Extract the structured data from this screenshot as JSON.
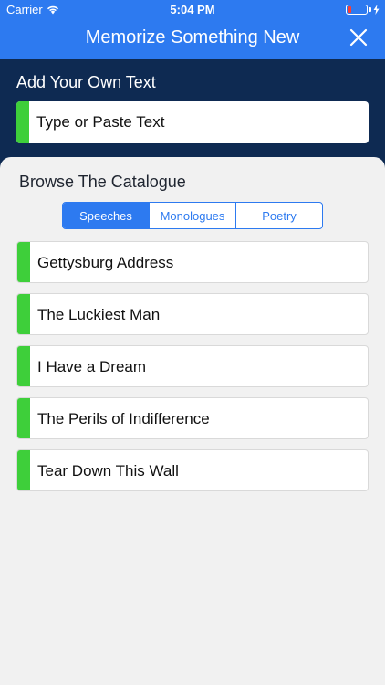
{
  "status_bar": {
    "carrier": "Carrier",
    "time": "5:04 PM"
  },
  "nav": {
    "title": "Memorize Something New"
  },
  "add_section": {
    "heading": "Add Your Own Text",
    "input_label": "Type or Paste Text"
  },
  "catalogue": {
    "heading": "Browse The Catalogue",
    "tabs": [
      {
        "label": "Speeches",
        "active": true
      },
      {
        "label": "Monologues",
        "active": false
      },
      {
        "label": "Poetry",
        "active": false
      }
    ],
    "items": [
      {
        "label": "Gettysburg Address"
      },
      {
        "label": "The Luckiest Man"
      },
      {
        "label": "I Have a Dream"
      },
      {
        "label": "The Perils of Indifference"
      },
      {
        "label": "Tear Down This Wall"
      }
    ]
  },
  "colors": {
    "header_blue": "#2d7af0",
    "navy": "#0e2a52",
    "accent_green": "#3ecf3a",
    "battery_red": "#ff3b30"
  }
}
